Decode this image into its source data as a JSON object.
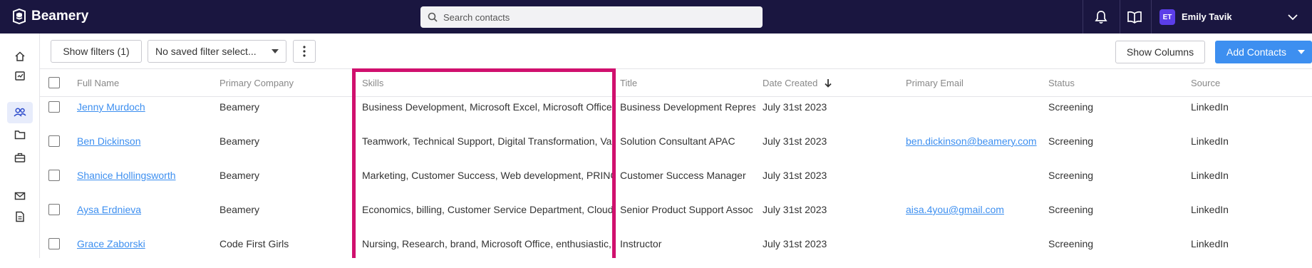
{
  "app": {
    "name": "Beamery"
  },
  "search": {
    "placeholder": "Search contacts"
  },
  "user": {
    "initials": "ET",
    "name": "Emily Tavik"
  },
  "toolbar": {
    "show_filters": "Show filters (1)",
    "saved_filter": "No saved filter select...",
    "show_columns": "Show Columns",
    "add_contacts": "Add Contacts"
  },
  "columns": [
    "Full Name",
    "Primary Company",
    "Skills",
    "Title",
    "Date Created",
    "Primary Email",
    "Status",
    "Source"
  ],
  "sort": {
    "column": "Date Created",
    "direction": "descending"
  },
  "rows": [
    {
      "name": "Jenny Murdoch",
      "company": "Beamery",
      "skills": "Business Development, Microsoft Excel, Microsoft Office",
      "title": "Business Development Repres",
      "date": "July 31st 2023",
      "email": "",
      "status": "Screening",
      "source": "LinkedIn"
    },
    {
      "name": "Ben Dickinson",
      "company": "Beamery",
      "skills": "Teamwork, Technical Support, Digital Transformation, Va",
      "title": "Solution Consultant APAC",
      "date": "July 31st 2023",
      "email": "ben.dickinson@beamery.com",
      "status": "Screening",
      "source": "LinkedIn"
    },
    {
      "name": "Shanice Hollingsworth",
      "company": "Beamery",
      "skills": "Marketing, Customer Success, Web development, PRINC",
      "title": "Customer Success Manager",
      "date": "July 31st 2023",
      "email": "",
      "status": "Screening",
      "source": "LinkedIn"
    },
    {
      "name": "Aysa Erdnieva",
      "company": "Beamery",
      "skills": "Economics, billing, Customer Service Department, Cloud,",
      "title": "Senior Product Support Assoc",
      "date": "July 31st 2023",
      "email": "aisa.4you@gmail.com",
      "status": "Screening",
      "source": "LinkedIn"
    },
    {
      "name": "Grace Zaborski",
      "company": "Code First Girls",
      "skills": "Nursing, Research, brand, Microsoft Office, enthusiastic,",
      "title": "Instructor",
      "date": "July 31st 2023",
      "email": "",
      "status": "Screening",
      "source": "LinkedIn"
    }
  ],
  "colors": {
    "topbar": "#1a1640",
    "accent": "#3d8ff0",
    "highlight": "#d0106e",
    "avatar": "#5b3ee8"
  }
}
